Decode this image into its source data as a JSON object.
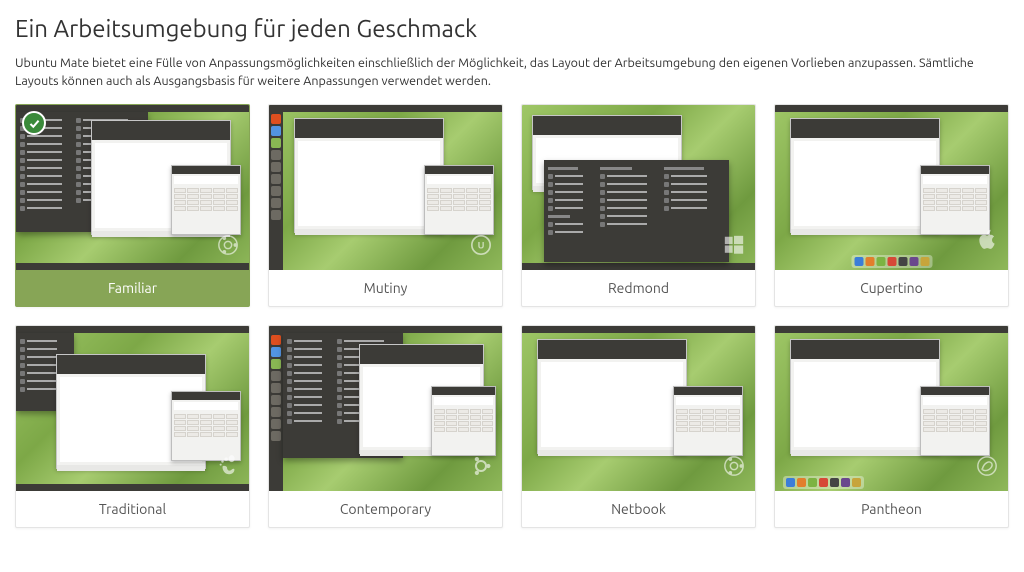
{
  "heading": "Ein Arbeitsumgebung für jeden Geschmack",
  "intro": "Ubuntu Mate bietet eine Fülle von Anpassungsmöglichkeiten einschließlich der Möglichkeit, das Layout der Arbeitsumgebung den eigenen Vorlieben anzupassen. Sämtliche Layouts können auch als Ausgangsbasis für weitere Anpassungen verwendet werden.",
  "layouts": {
    "selected_index": 0,
    "items": [
      {
        "name": "Familiar"
      },
      {
        "name": "Mutiny"
      },
      {
        "name": "Redmond"
      },
      {
        "name": "Cupertino"
      },
      {
        "name": "Traditional"
      },
      {
        "name": "Contemporary"
      },
      {
        "name": "Netbook"
      },
      {
        "name": "Pantheon"
      }
    ]
  },
  "colors": {
    "selected_bg": "#87a556",
    "check_bg": "#3a8a3a"
  }
}
